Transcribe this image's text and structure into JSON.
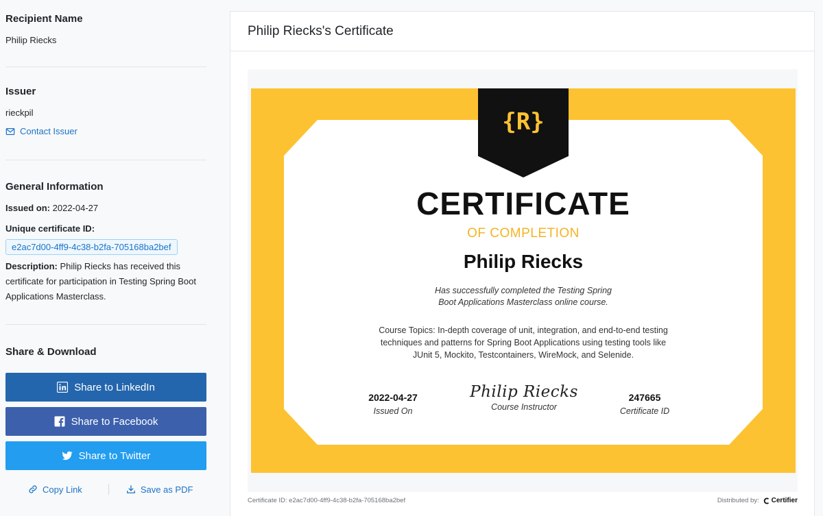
{
  "sidebar": {
    "recipient": {
      "heading": "Recipient Name",
      "value": "Philip Riecks"
    },
    "issuer": {
      "heading": "Issuer",
      "value": "rieckpil",
      "contact_label": "Contact Issuer"
    },
    "general": {
      "heading": "General Information",
      "issued_label": "Issued on:",
      "issued_value": "2022-04-27",
      "id_label": "Unique certificate ID:",
      "id_value": "e2ac7d00-4ff9-4c38-b2fa-705168ba2bef",
      "desc_label": "Description:",
      "desc_value": "Philip Riecks has received this certificate for participation in Testing Spring Boot Applications Masterclass."
    },
    "share": {
      "heading": "Share & Download",
      "linkedin_label": "Share to LinkedIn",
      "facebook_label": "Share to Facebook",
      "twitter_label": "Share to Twitter",
      "copy_label": "Copy Link",
      "pdf_label": "Save as PDF"
    }
  },
  "main": {
    "title": "Philip Riecks's Certificate",
    "certificate": {
      "logo_text": "{R}",
      "heading": "CERTIFICATE",
      "subheading": "OF COMPLETION",
      "recipient": "Philip Riecks",
      "completion_text": "Has successfully completed the Testing Spring Boot Applications Masterclass online course.",
      "topics_text": "Course Topics: In-depth coverage of unit, integration, and end-to-end testing techniques and patterns for Spring Boot Applications using testing tools like JUnit 5, Mockito, Testcontainers, WireMock, and Selenide.",
      "date_value": "2022-04-27",
      "date_label": "Issued On",
      "signature": "Philip Riecks",
      "instructor_label": "Course Instructor",
      "id_value": "247665",
      "id_label": "Certificate ID"
    },
    "footer": {
      "cert_id_text": "Certificate ID: e2ac7d00-4ff9-4c38-b2fa-705168ba2bef",
      "distributed_label": "Distributed by:",
      "brand": "Certifier"
    }
  },
  "colors": {
    "accent_link": "#1a73c8",
    "linkedin": "#2466ad",
    "facebook": "#3c60ac",
    "twitter": "#229df0",
    "certificate_gold": "#fdc231"
  },
  "icons": [
    "envelope-icon",
    "linkedin-icon",
    "facebook-icon",
    "twitter-icon",
    "link-icon",
    "download-icon",
    "certifier-logo-icon"
  ]
}
